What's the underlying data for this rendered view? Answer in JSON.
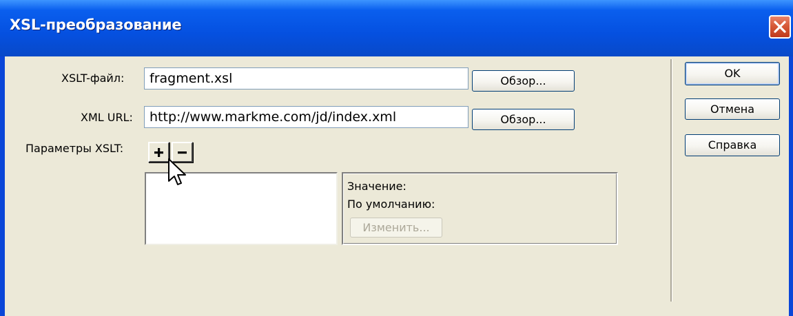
{
  "window": {
    "title": "XSL-преобразование",
    "close_label": "×"
  },
  "form": {
    "xslt_file": {
      "label": "XSLT-файл:",
      "value": "fragment.xsl",
      "browse_label": "Обзор..."
    },
    "xml_url": {
      "label": "XML URL:",
      "value": "http://www.markme.com/jd/index.xml",
      "browse_label": "Обзор..."
    },
    "params": {
      "label": "Параметры XSLT:",
      "add_symbol": "+",
      "remove_symbol": "−"
    },
    "value_panel": {
      "value_label": "Значение:",
      "default_label": "По умолчанию:",
      "edit_label": "Изменить..."
    }
  },
  "actions": {
    "ok_label": "OK",
    "cancel_label": "Отмена",
    "help_label": "Справка"
  },
  "colors": {
    "titlebar": "#0550e0",
    "dialog_bg": "#ece9d8",
    "close": "#d75a38"
  }
}
